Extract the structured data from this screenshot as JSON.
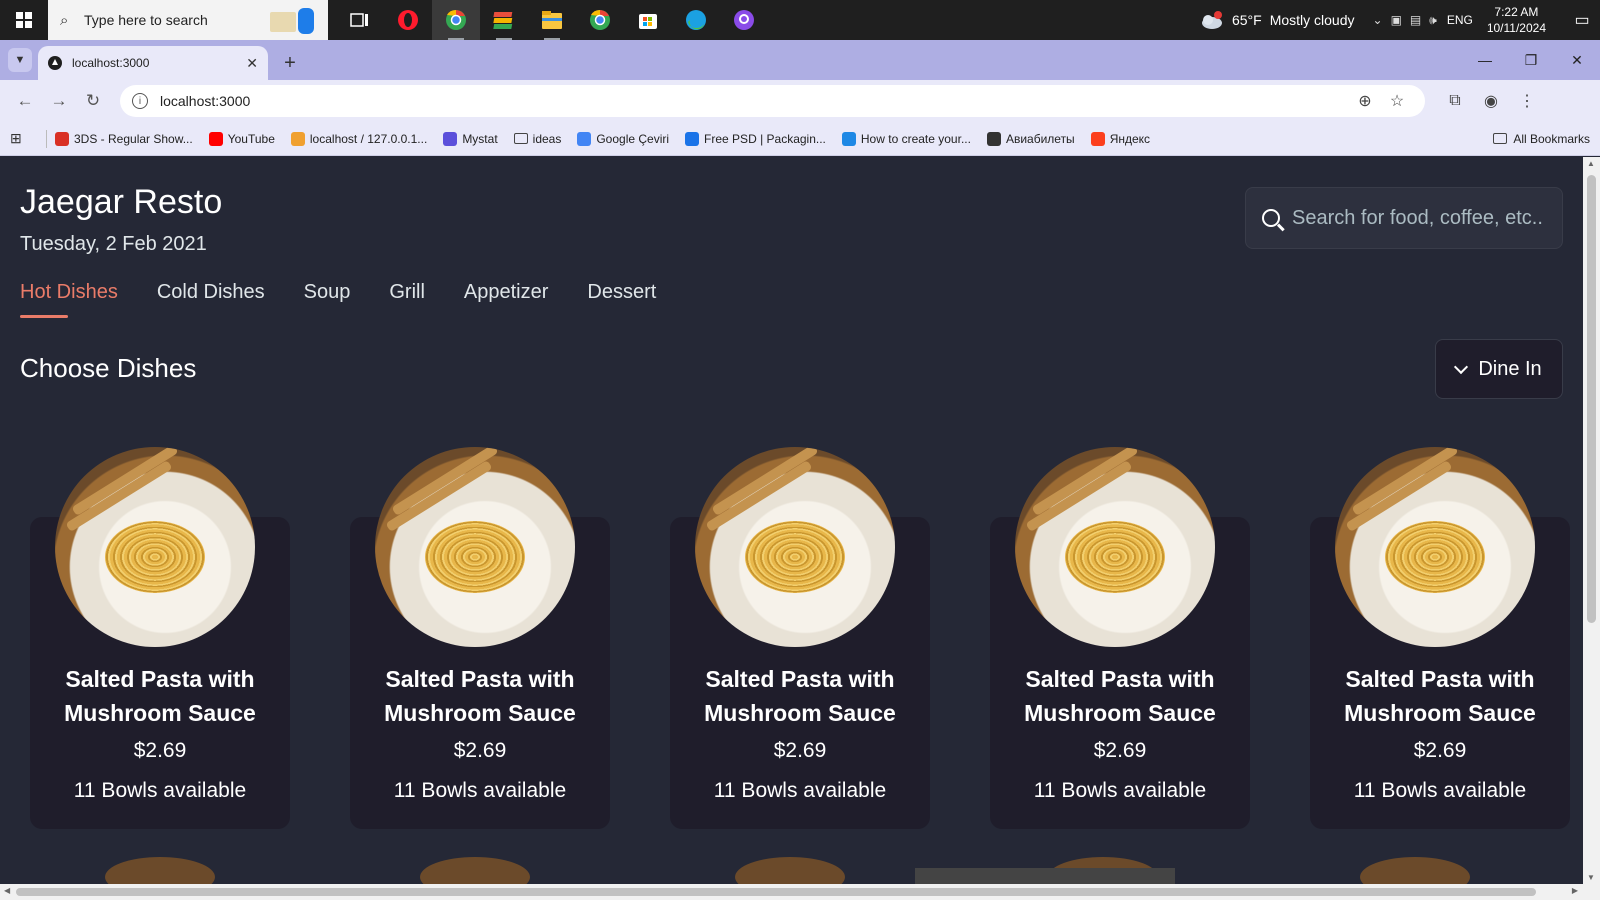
{
  "taskbar": {
    "search_placeholder": "Type here to search",
    "weather_temp": "65°F",
    "weather_text": "Mostly cloudy",
    "weather_badge": "1",
    "lang": "ENG",
    "time": "7:22 AM",
    "date": "10/11/2024",
    "apps": [
      "task-view",
      "opera",
      "chrome-active",
      "stack",
      "file-explorer",
      "chrome",
      "store",
      "edge",
      "github"
    ]
  },
  "browser": {
    "tab_title": "localhost:3000",
    "url": "localhost:3000",
    "bookmarks": [
      {
        "label": "3DS - Regular Show...",
        "color": "#d93025"
      },
      {
        "label": "YouTube",
        "color": "#ff0000"
      },
      {
        "label": "localhost / 127.0.0.1...",
        "color": "#f0a030"
      },
      {
        "label": "Mystat",
        "color": "#5b4fdb"
      },
      {
        "label": "ideas",
        "color": "folder"
      },
      {
        "label": "Google Çeviri",
        "color": "#4285f4"
      },
      {
        "label": "Free PSD | Packagin...",
        "color": "#1a73e8"
      },
      {
        "label": "How to create your...",
        "color": "#1e88e5"
      },
      {
        "label": "Авиабилеты",
        "color": "#333333"
      },
      {
        "label": "Яндекс",
        "color": "#fc3f1d"
      }
    ],
    "all_bookmarks": "All Bookmarks"
  },
  "app": {
    "title": "Jaegar Resto",
    "date": "Tuesday, 2 Feb 2021",
    "search_placeholder": "Search for food, coffee, etc..",
    "categories": [
      "Hot Dishes",
      "Cold Dishes",
      "Soup",
      "Grill",
      "Appetizer",
      "Dessert"
    ],
    "active_category": "Hot Dishes",
    "section_title": "Choose Dishes",
    "order_type": "Dine In",
    "accent": "#ea7c69",
    "dishes": [
      {
        "name": "Salted Pasta with Mushroom Sauce",
        "price": "$2.69",
        "availability": "11 Bowls available"
      },
      {
        "name": "Salted Pasta with Mushroom Sauce",
        "price": "$2.69",
        "availability": "11 Bowls available"
      },
      {
        "name": "Salted Pasta with Mushroom Sauce",
        "price": "$2.69",
        "availability": "11 Bowls available"
      },
      {
        "name": "Salted Pasta with Mushroom Sauce",
        "price": "$2.69",
        "availability": "11 Bowls available"
      },
      {
        "name": "Salted Pasta with Mushroom Sauce",
        "price": "$2.69",
        "availability": "11 Bowls available"
      }
    ]
  }
}
